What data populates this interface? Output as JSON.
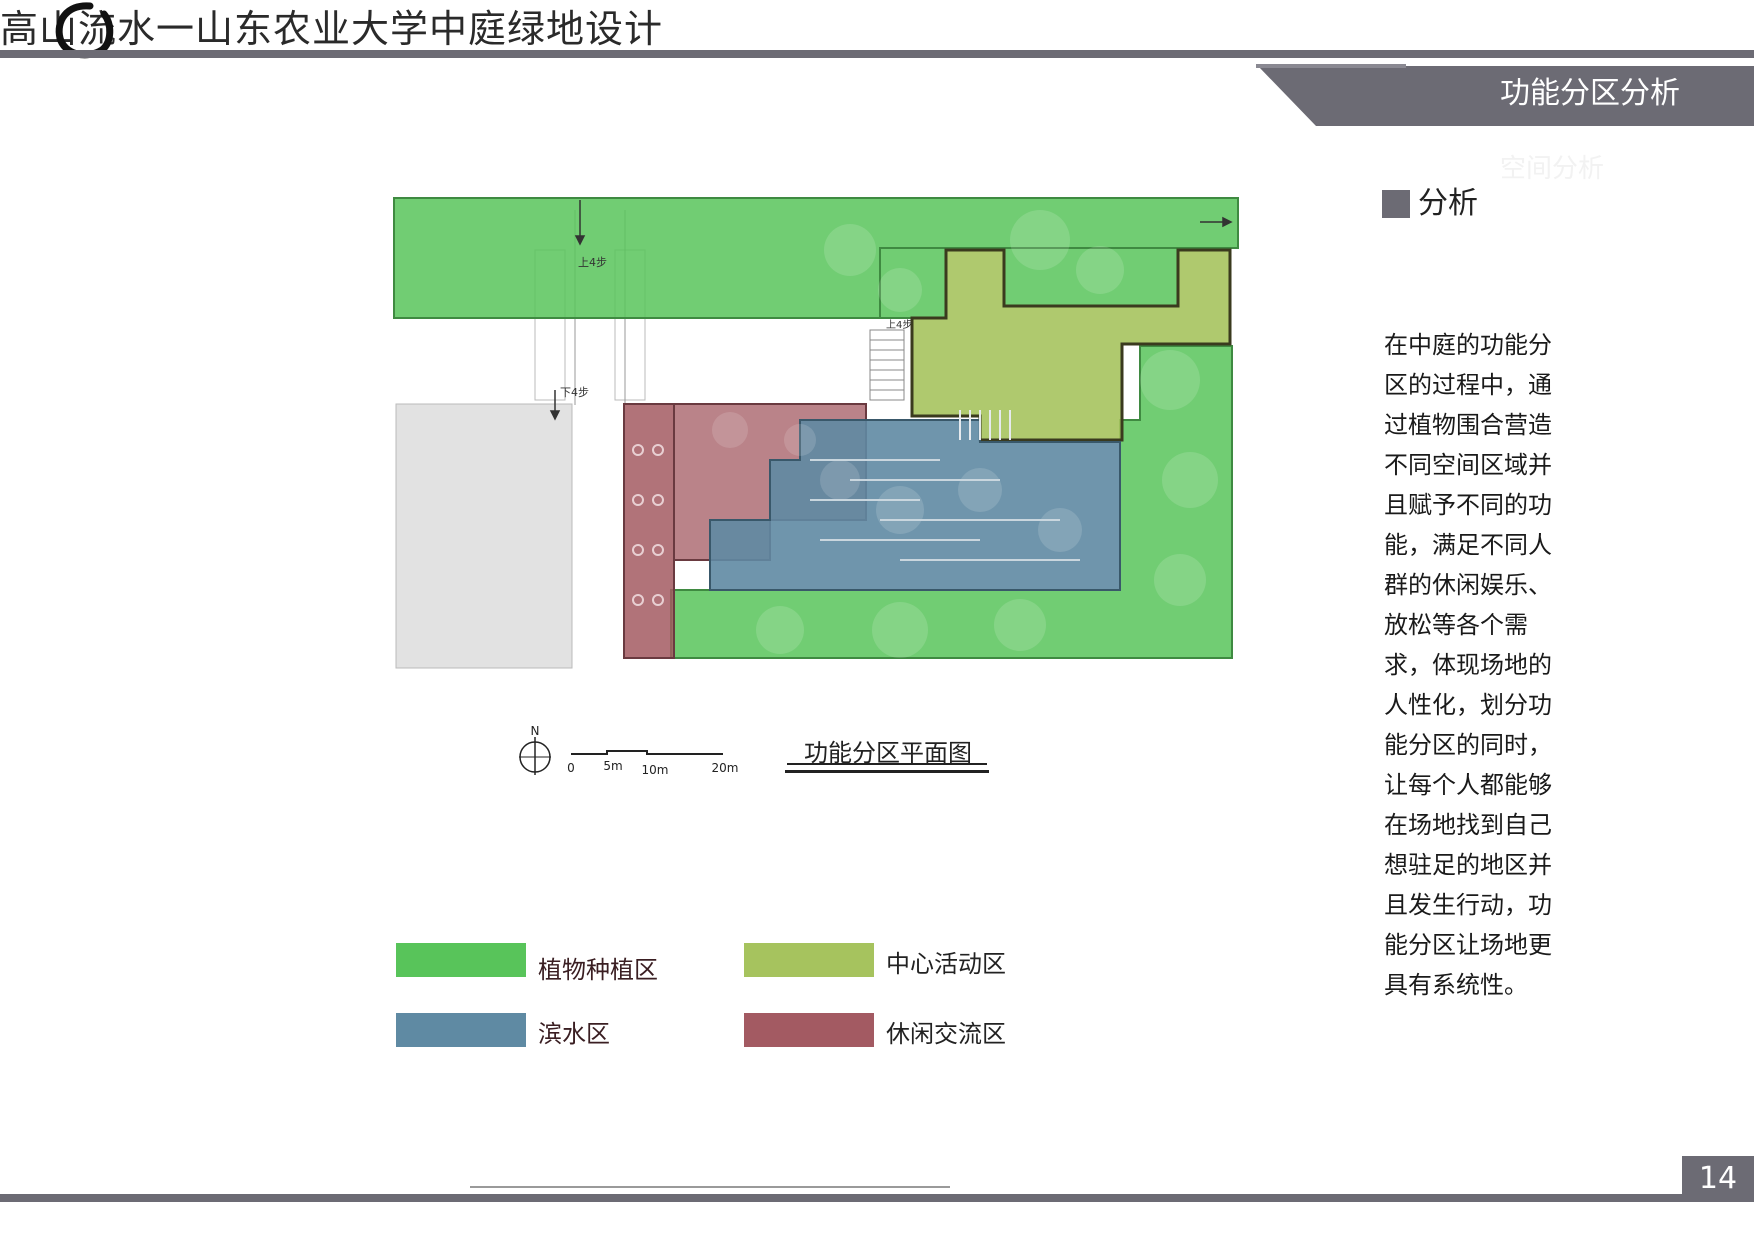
{
  "header": {
    "title_prefix": "高山流水",
    "title_rest": "一山东农业大学中庭绿地设计",
    "section_label": "功能分区分析",
    "ghost_label": "空间分析",
    "bar_color": "#6c6b74"
  },
  "analysis": {
    "title": "分析",
    "body": "在中庭的功能分区的过程中，通过植物围合营造不同空间区域并且赋予不同的功能，满足不同人群的休闲娱乐、放松等各个需求，体现场地的人性化，划分功能分区的同时，让每个人都能够在场地找到自己想驻足的地区并且发生行动，功能分区让场地更具有系统性。"
  },
  "plan": {
    "caption": "功能分区平面图",
    "north_label": "N",
    "step_up": "上4步",
    "step_down": "下4步",
    "step_right": "上4步",
    "scale_labels": [
      "0",
      "5m",
      "10m",
      "20m"
    ],
    "zone_colors": {
      "planting": "#58c45a",
      "center": "#a6c35e",
      "water": "#5f8aa3",
      "leisure": "#a35a62"
    }
  },
  "legend": [
    {
      "label": "植物种植区",
      "color": "#58c45a"
    },
    {
      "label": "中心活动区",
      "color": "#a6c35e"
    },
    {
      "label": "滨水区",
      "color": "#5f8aa3"
    },
    {
      "label": "休闲交流区",
      "color": "#a35a62"
    }
  ],
  "footer": {
    "page_number": "14"
  }
}
